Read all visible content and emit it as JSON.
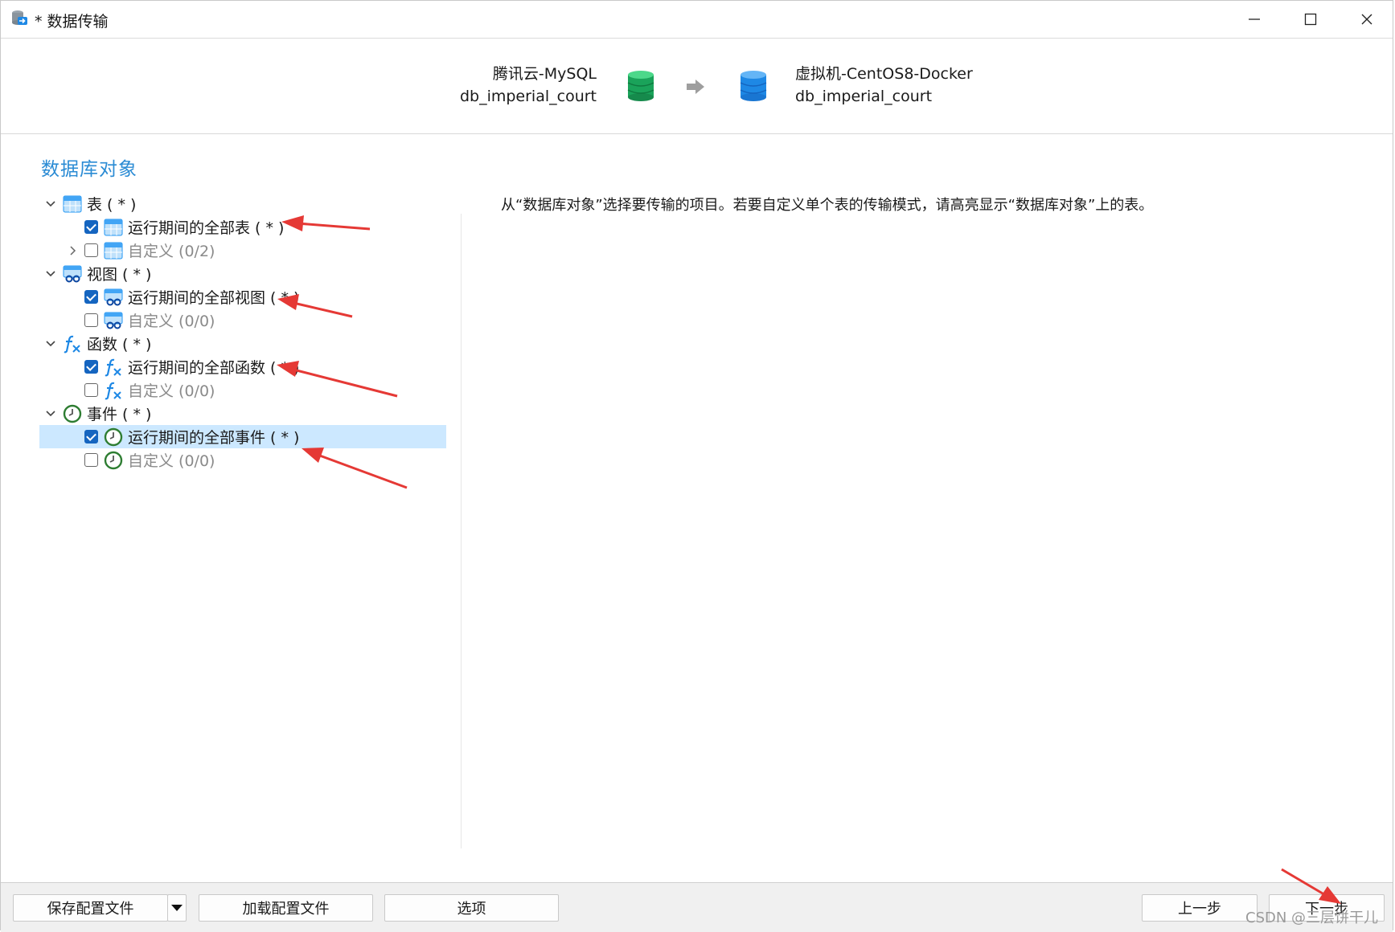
{
  "window": {
    "title": "* 数据传输",
    "icon": "db-transfer-icon"
  },
  "header": {
    "source": {
      "connection": "腾讯云-MySQL",
      "database": "db_imperial_court",
      "color": "#1aa35a"
    },
    "target": {
      "connection": "虚拟机-CentOS8-Docker",
      "database": "db_imperial_court",
      "color": "#1e88e5"
    }
  },
  "section_title": "数据库对象",
  "tree": {
    "tables": {
      "label": "表 ( * )",
      "all": "运行期间的全部表 ( * )",
      "custom": "自定义 (0/2)"
    },
    "views": {
      "label": "视图 ( * )",
      "all": "运行期间的全部视图 ( * )",
      "custom": "自定义 (0/0)"
    },
    "functions": {
      "label": "函数 ( * )",
      "all": "运行期间的全部函数 ( * )",
      "custom": "自定义 (0/0)"
    },
    "events": {
      "label": "事件 ( * )",
      "all": "运行期间的全部事件 ( * )",
      "custom": "自定义 (0/0)"
    }
  },
  "description": "从“数据库对象”选择要传输的项目。若要自定义单个表的传输模式，请高亮显示“数据库对象”上的表。",
  "buttons": {
    "save_config": "保存配置文件",
    "load_config": "加载配置文件",
    "options": "选项",
    "prev": "上一步",
    "next": "下一步"
  },
  "watermark": "CSDN @三层饼干儿",
  "colors": {
    "accent": "#2a8bd4",
    "selection": "#cce8ff",
    "annotation": "#e53935"
  }
}
